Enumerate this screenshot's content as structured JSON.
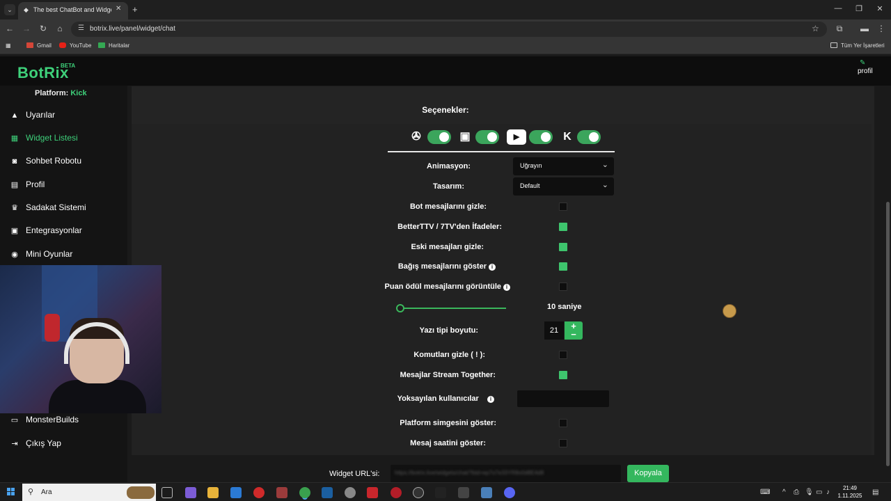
{
  "browser": {
    "tab_title": "The best ChatBot and Widgets",
    "url": "botrix.live/panel/widget/chat",
    "bookmarks": [
      "Gmail",
      "YouTube",
      "Haritalar"
    ],
    "all_bookmarks_label": "Tüm Yer İşaretleri"
  },
  "site": {
    "logo": "BotRix",
    "badge": "BETA",
    "profile_label": "profil"
  },
  "sidebar": {
    "platform_prefix": "Platform:",
    "platform_value": "Kick",
    "items": [
      {
        "label": "Uyarılar",
        "icon": "warning-icon"
      },
      {
        "label": "Widget Listesi",
        "icon": "grid-icon",
        "active": true
      },
      {
        "label": "Sohbet Robotu",
        "icon": "robot-icon"
      },
      {
        "label": "Profil",
        "icon": "id-card-icon"
      },
      {
        "label": "Sadakat Sistemi",
        "icon": "trophy-icon"
      },
      {
        "label": "Entegrasyonlar",
        "icon": "integration-icon"
      },
      {
        "label": "Mini Oyunlar",
        "icon": "gamepad-icon"
      },
      {
        "label": "MonsterBuilds",
        "icon": "laptop-icon"
      },
      {
        "label": "Çıkış Yap",
        "icon": "logout-icon"
      }
    ]
  },
  "options": {
    "heading": "Seçenekler:",
    "platforms": [
      "kick-logo-icon",
      "twitch-icon",
      "youtube-icon",
      "kick-k-icon"
    ],
    "animation_label": "Animasyon:",
    "animation_value": "Uğrayın",
    "design_label": "Tasarım:",
    "design_value": "Default",
    "rows": [
      {
        "label": "Bot mesajlarını gizle:",
        "checked": false
      },
      {
        "label": "BetterTTV / 7TV'den İfadeler:",
        "checked": true
      },
      {
        "label": "Eski mesajları gizle:",
        "checked": true
      },
      {
        "label": "Bağış mesajlarını göster",
        "checked": true
      },
      {
        "label": "Puan ödül mesajlarını görüntüle",
        "checked": false
      }
    ],
    "slider_value_label": "10 saniye",
    "font_size_label": "Yazı tipi boyutu:",
    "font_size_value": "21",
    "plus": "+",
    "minus": "−",
    "rows2": [
      {
        "label": "Komutları gizle ( ! ):",
        "checked": false
      },
      {
        "label": "Mesajlar Stream Together:",
        "checked": true
      }
    ],
    "ignored_users_label": "Yoksayılan kullanıcılar",
    "rows3": [
      {
        "label": "Platform simgesini göster:",
        "checked": false
      },
      {
        "label": "Mesaj saatini göster:",
        "checked": false
      }
    ],
    "widget_url_label": "Widget URL'si:",
    "widget_url_value": "https://botrix.live/widgets/chat/?bid=ep7o7e33YR8o0d8E4d8",
    "copy_button": "Kopyala"
  },
  "taskbar": {
    "search_placeholder": "Ara",
    "time": "21:49",
    "date": "1.11.2025"
  }
}
